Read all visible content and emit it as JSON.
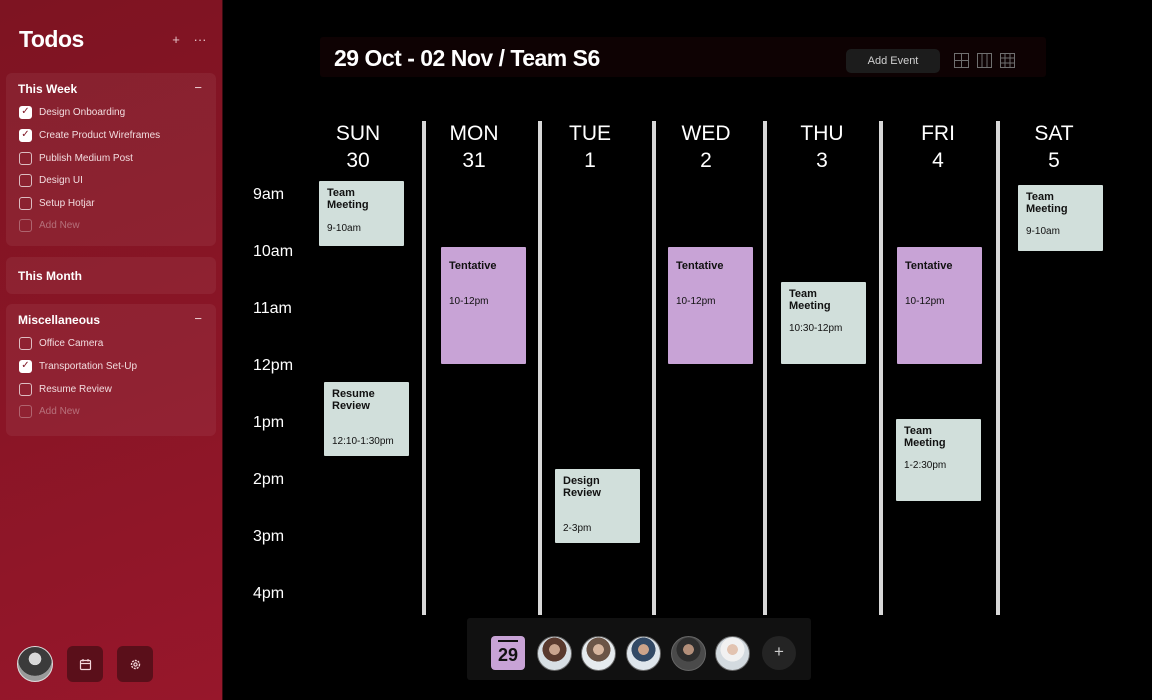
{
  "sidebar": {
    "title": "Todos",
    "add_icon": "+",
    "more_icon": "···",
    "groups": [
      {
        "title": "This Week",
        "toggle": "−",
        "items": [
          {
            "label": "Design Onboarding",
            "checked": true
          },
          {
            "label": "Create Product Wireframes",
            "checked": true
          },
          {
            "label": "Publish Medium Post",
            "checked": false
          },
          {
            "label": "Design UI",
            "checked": false
          },
          {
            "label": "Setup Hotjar",
            "checked": false
          }
        ],
        "add_new": "Add New"
      },
      {
        "title": "This Month"
      },
      {
        "title": "Miscellaneous",
        "toggle": "−",
        "items": [
          {
            "label": "Office Camera",
            "checked": false
          },
          {
            "label": "Transportation Set-Up",
            "checked": true
          },
          {
            "label": "Resume Review",
            "checked": false
          }
        ],
        "add_new": "Add New"
      }
    ],
    "bottom_icons": [
      "avatar",
      "calendar-icon",
      "settings-icon"
    ]
  },
  "header": {
    "title": "29 Oct - 02 Nov / Team S6",
    "add_event_label": "Add Event",
    "view_icons": [
      "grid-view-icon",
      "week-view-icon",
      "month-view-icon"
    ]
  },
  "calendar": {
    "days": [
      {
        "name": "SUN",
        "date": "30"
      },
      {
        "name": "MON",
        "date": "31"
      },
      {
        "name": "TUE",
        "date": "1"
      },
      {
        "name": "WED",
        "date": "2"
      },
      {
        "name": "THU",
        "date": "3"
      },
      {
        "name": "FRI",
        "date": "4"
      },
      {
        "name": "SAT",
        "date": "5"
      }
    ],
    "times": [
      "9am",
      "10am",
      "11am",
      "12pm",
      "1pm",
      "2pm",
      "3pm",
      "4pm"
    ],
    "events": [
      {
        "title": "Team Meeting",
        "time": "9-10am",
        "day": "SUN",
        "color": "#d1dfdb"
      },
      {
        "title": "Resume Review",
        "time": "12:10-1:30pm",
        "day": "SUN",
        "color": "#d1dfdb"
      },
      {
        "title": "Tentative",
        "time": "10-12pm",
        "day": "MON",
        "color": "#c8a3d6"
      },
      {
        "title": "Design Review",
        "time": "2-3pm",
        "day": "TUE",
        "color": "#d1dfdb"
      },
      {
        "title": "Tentative",
        "time": "10-12pm",
        "day": "WED",
        "color": "#c8a3d6"
      },
      {
        "title": "Team Meeting",
        "time": "10:30-12pm",
        "day": "THU",
        "color": "#d1dfdb"
      },
      {
        "title": "Tentative",
        "time": "10-12pm",
        "day": "FRI",
        "color": "#c8a3d6"
      },
      {
        "title": "Team Meeting",
        "time": "1-2:30pm",
        "day": "FRI",
        "color": "#d1dfdb"
      },
      {
        "title": "Team Meeting",
        "time": "9-10am",
        "day": "SAT",
        "color": "#d1dfdb"
      }
    ]
  },
  "dock": {
    "calendar_date": "29",
    "members": [
      "team-member-1",
      "team-member-2",
      "team-member-3",
      "team-member-4",
      "team-member-5"
    ],
    "add_icon": "+"
  }
}
